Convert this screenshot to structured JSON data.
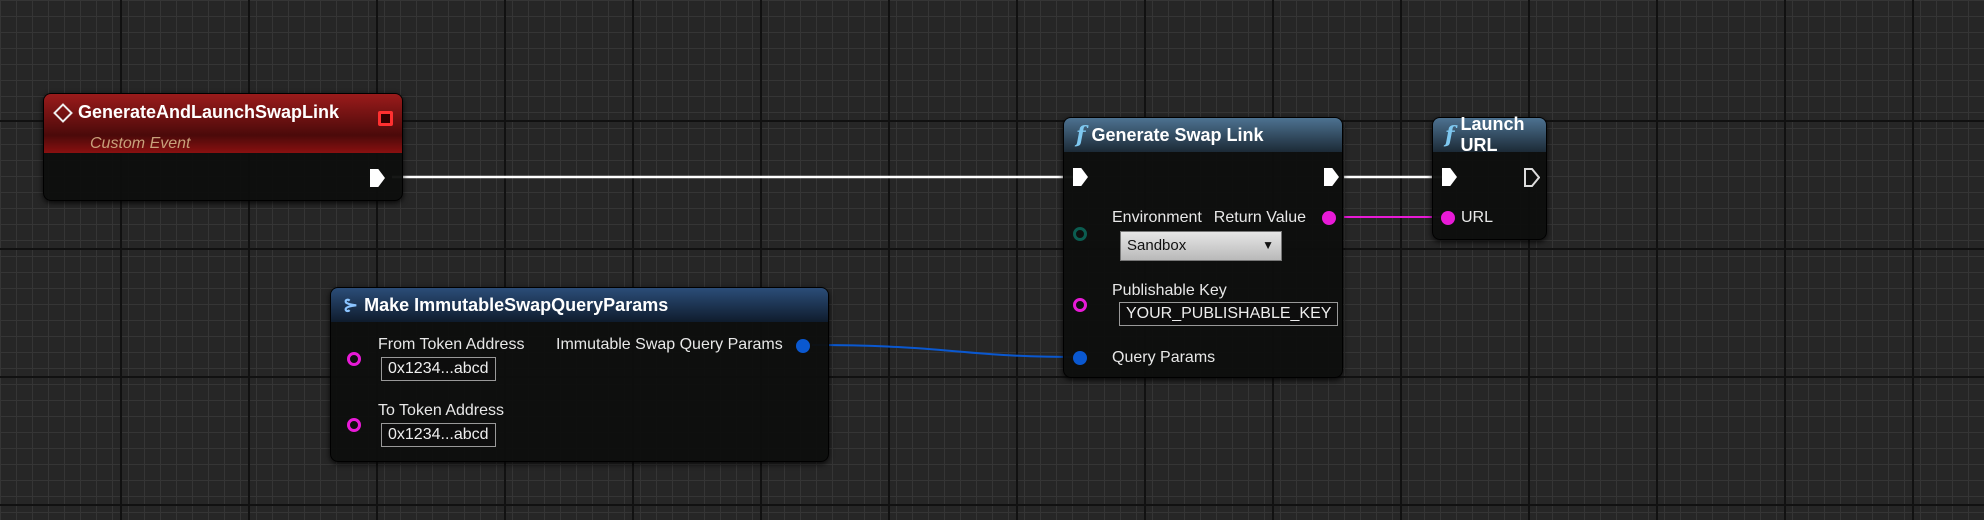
{
  "colors": {
    "exec": "#ffffff",
    "string": "#e81ad7",
    "struct": "#0a58d0",
    "enum": "#0b5c50",
    "event_header": "#8a1212",
    "function_header": "#4d7291"
  },
  "event_node": {
    "title": "GenerateAndLaunchSwapLink",
    "subtitle": "Custom Event"
  },
  "generate_node": {
    "title": "Generate Swap Link",
    "icon": "function-icon",
    "environment_label": "Environment",
    "environment_value": "Sandbox",
    "key_label": "Publishable Key",
    "key_value": "YOUR_PUBLISHABLE_KEY",
    "query_label": "Query Params",
    "return_label": "Return Value"
  },
  "launch_node": {
    "title": "Launch URL",
    "icon": "function-icon",
    "url_label": "URL"
  },
  "make_node": {
    "title": "Make ImmutableSwapQueryParams",
    "from_label": "From Token Address",
    "from_value": "0x1234...abcd",
    "to_label": "To Token Address",
    "to_value": "0x1234...abcd",
    "output_label": "Immutable Swap Query Params"
  }
}
